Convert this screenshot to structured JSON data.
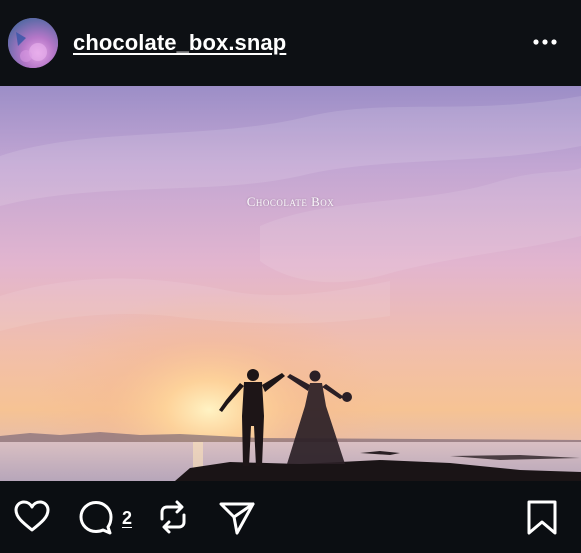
{
  "post": {
    "username": "chocolate_box.snap",
    "watermark": "Chocolate Box",
    "comment_count": "2"
  },
  "icons": {
    "avatar": "avatar-image",
    "more": "more-dots-icon",
    "like": "heart-icon",
    "comment": "comment-bubble-icon",
    "repost": "repost-icon",
    "share": "send-icon",
    "save": "bookmark-icon"
  },
  "colors": {
    "background": "#0b0e12",
    "text": "#ffffff",
    "sky_top": "#b9a5d2",
    "sky_horizon": "#f3b98a",
    "sea": "#cbb7c6"
  }
}
